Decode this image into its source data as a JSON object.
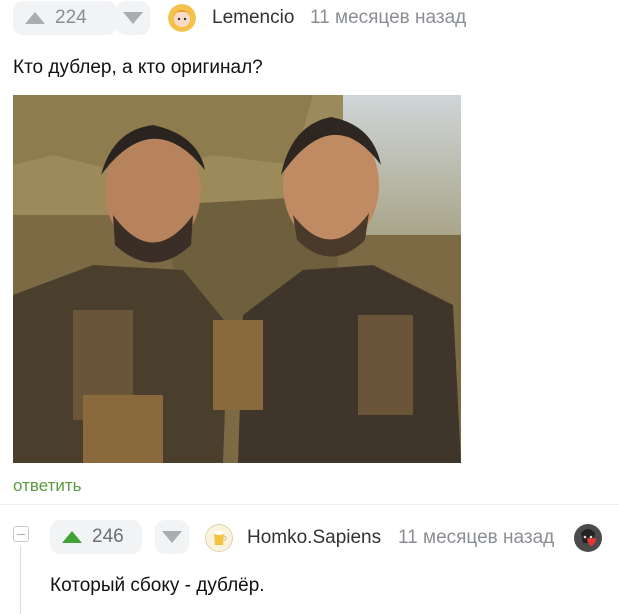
{
  "post": {
    "rating": "224",
    "author": "Lemencio",
    "time": "11 месяцев назад",
    "text": "Кто дублер, а кто оригинал?",
    "reply_label": "ответить"
  },
  "reply": {
    "rating": "246",
    "author": "Homko.Sapiens",
    "time": "11 месяцев назад",
    "text": "Который сбоку - дублёр."
  },
  "colors": {
    "upvote_active": "#41a335",
    "reply_link": "#5b9a3e",
    "muted": "#8a8e93"
  }
}
